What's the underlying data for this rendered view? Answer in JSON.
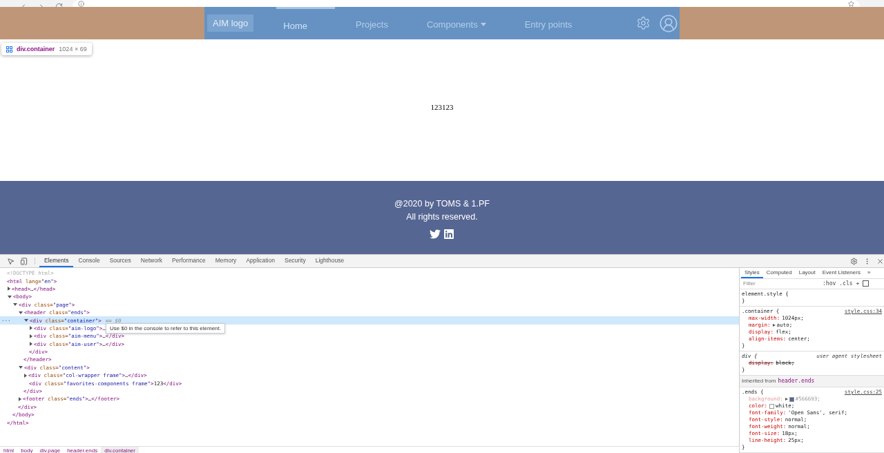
{
  "site": {
    "logo": "AIM logo",
    "nav": [
      {
        "label": "Home",
        "selected": true,
        "dropdown": false
      },
      {
        "label": "Projects",
        "selected": false,
        "dropdown": false
      },
      {
        "label": "Components",
        "selected": false,
        "dropdown": true
      },
      {
        "label": "Entry points",
        "selected": false,
        "dropdown": false
      }
    ],
    "content": "123123",
    "footer": {
      "lines": [
        "@2020 by TOMS & 1.PF",
        "All rights reserved."
      ]
    }
  },
  "inspect_tooltip": {
    "element": "div.container",
    "size": "1024 × 69"
  },
  "devtools": {
    "tabs": [
      {
        "label": "Elements",
        "selected": true
      },
      {
        "label": "Console",
        "selected": false
      },
      {
        "label": "Sources",
        "selected": false
      },
      {
        "label": "Network",
        "selected": false
      },
      {
        "label": "Performance",
        "selected": false
      },
      {
        "label": "Memory",
        "selected": false
      },
      {
        "label": "Application",
        "selected": false
      },
      {
        "label": "Security",
        "selected": false
      },
      {
        "label": "Lighthouse",
        "selected": false
      }
    ],
    "dom": [
      {
        "kind": "doctype",
        "text": "<!DOCTYPE html>",
        "selected": false
      },
      {
        "kind": "element",
        "text": "<html lang=\"en\">",
        "selected": false,
        "close": "</html>",
        "children": [
          {
            "kind": "element",
            "text": "<head>…</head>",
            "expanded": false,
            "selected": false
          },
          {
            "kind": "element",
            "text": "<body>",
            "expanded": true,
            "selected": false,
            "close": "</body>",
            "children": [
              {
                "kind": "element",
                "text": "<div class=\"page\">",
                "expanded": true,
                "selected": false,
                "close": "</div>",
                "children": [
                  {
                    "kind": "element",
                    "text": "<header class=\"ends\">",
                    "expanded": true,
                    "selected": false,
                    "close": "</header>",
                    "children": [
                      {
                        "kind": "element",
                        "text": "<div class=\"container\">",
                        "gutter": "···",
                        "suffix": "== $0",
                        "expanded": true,
                        "selected": true,
                        "close": "</div>",
                        "children": [
                          {
                            "kind": "element",
                            "text": "<div class=\"aim-logo\">…",
                            "expanded": false,
                            "selected": false
                          },
                          {
                            "kind": "element",
                            "text": "<div class=\"aim-menu\">…</div>",
                            "expanded": false,
                            "selected": false
                          },
                          {
                            "kind": "element",
                            "text": "<div class=\"aim-user\">…</div>",
                            "expanded": false,
                            "selected": false
                          }
                        ]
                      }
                    ]
                  },
                  {
                    "kind": "element",
                    "text": "<div class=\"content\">",
                    "expanded": true,
                    "selected": false,
                    "close": "</div>",
                    "children": [
                      {
                        "kind": "element",
                        "text": "<div class=\"col-wrapper frame\">…</div>",
                        "expanded": false,
                        "selected": false
                      },
                      {
                        "kind": "element",
                        "text": "<div class=\"favorites-components frame\">123</div>",
                        "selected": false
                      }
                    ]
                  },
                  {
                    "kind": "element",
                    "text": "<footer class=\"ends\">…</footer>",
                    "expanded": false,
                    "selected": false
                  }
                ]
              }
            ]
          }
        ]
      }
    ],
    "hint": "Use $0 in the console to refer to this element.",
    "breadcrumbs": [
      {
        "label": "html",
        "selected": false
      },
      {
        "label": "body",
        "selected": false
      },
      {
        "label": "div.page",
        "selected": false
      },
      {
        "label": "header.ends",
        "selected": false
      },
      {
        "label": "div.container",
        "selected": true
      }
    ],
    "styles": {
      "tabs": [
        {
          "label": "Styles",
          "selected": true
        },
        {
          "label": "Computed",
          "selected": false
        },
        {
          "label": "Layout",
          "selected": false
        },
        {
          "label": "Event Listeners",
          "selected": false
        }
      ],
      "more": "»",
      "filter_placeholder": "Filter",
      "hov": ":hov",
      "cls": ".cls",
      "add": "+",
      "rules": [
        {
          "kind": "rule",
          "selector": "element.style {",
          "close": "}"
        },
        {
          "kind": "rule",
          "selector": ".container {",
          "source": "style.css:34",
          "close": "}",
          "declarations": [
            {
              "property": "max-width:",
              "value": "1024px;"
            },
            {
              "property": "margin:",
              "value": "auto;",
              "expandable": true
            },
            {
              "property": "display:",
              "value": "flex;"
            },
            {
              "property": "align-items:",
              "value": "center;"
            }
          ]
        },
        {
          "kind": "user_agent",
          "selector": "div {",
          "source": "user agent stylesheet",
          "close": "}",
          "declarations": [
            {
              "property": "display:",
              "value": "block;",
              "overridden": true
            }
          ]
        },
        {
          "kind": "inherited",
          "label": "Inherited from",
          "element": "header.ends"
        },
        {
          "kind": "rule",
          "selector": ".ends {",
          "source": "style.css:25",
          "close": "}",
          "declarations": [
            {
              "property": "background:",
              "value": "#566693;",
              "expandable": true,
              "inactive": true,
              "color": "#566693"
            },
            {
              "property": "color:",
              "value": "white;",
              "color": "#ffffff"
            },
            {
              "property": "font-family:",
              "value": "'Open Sans', serif;"
            },
            {
              "property": "font-style:",
              "value": "normal;"
            },
            {
              "property": "font-weight:",
              "value": "normal;"
            },
            {
              "property": "font-size:",
              "value": "18px;"
            },
            {
              "property": "line-height:",
              "value": "25px;"
            }
          ]
        }
      ]
    }
  }
}
